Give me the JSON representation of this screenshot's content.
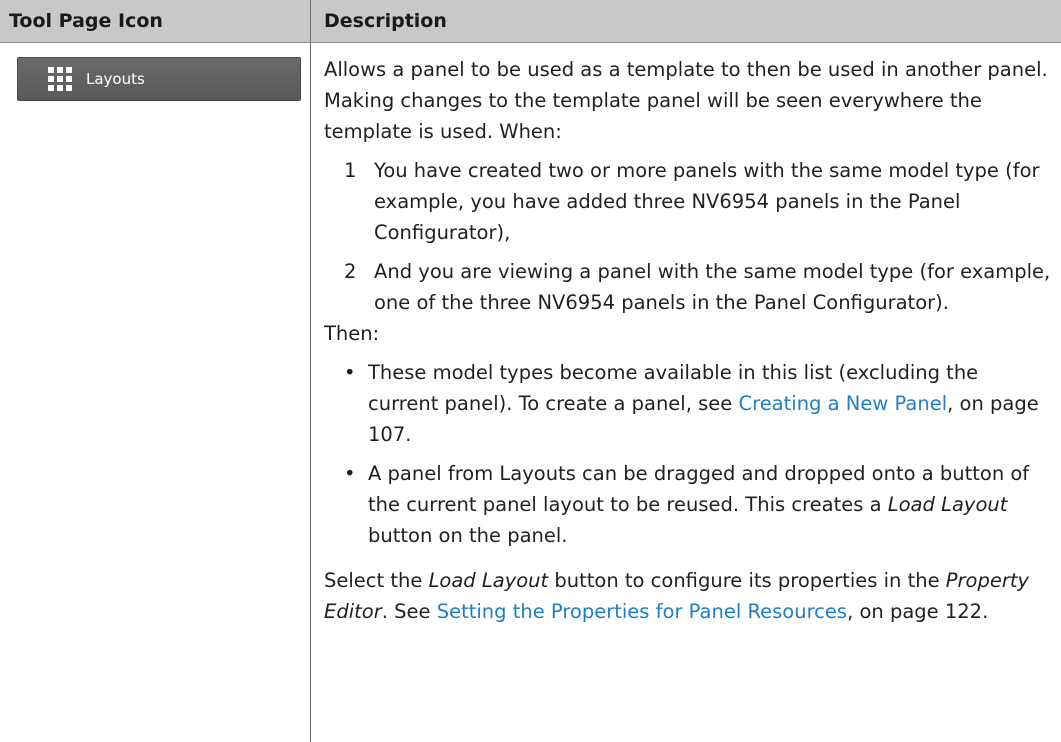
{
  "table": {
    "headers": [
      "Tool Page Icon",
      "Description"
    ],
    "row": {
      "tool_label": "Layouts",
      "tool_icon": "grid-icon",
      "intro": "Allows a panel to be used as a template to then be used in another panel. Making changes to the template panel will be seen everywhere the template is used. When:",
      "numbered": [
        {
          "num": "1",
          "text": "You have created two or more panels with the same model type (for example, you have added three NV6954 panels in the Panel Configurator),"
        },
        {
          "num": "2",
          "text": "And you are viewing a panel with the same model type (for example, one of the three NV6954 panels in the Panel Configurator)."
        }
      ],
      "then": "Then:",
      "bullet1": {
        "bullet": "•",
        "before": "These model types become available in this list (excluding the current panel). To create a panel, see ",
        "link": "Creating a New Panel",
        "after": ", on page 107."
      },
      "bullet2": {
        "bullet": "•",
        "before": "A panel from Layouts can be dragged and dropped onto a button of the current panel layout to be reused. This creates a ",
        "italic": "Load Layout",
        "after": " button on the panel."
      },
      "closing": {
        "t1": "Select the ",
        "i1": "Load Layout",
        "t2": " button to configure its properties in the ",
        "i2": "Property Editor",
        "t3": ". See ",
        "link": "Setting the Properties for Panel Resources",
        "t4": ", on page 122."
      }
    }
  },
  "colors": {
    "header_bg": "#c8c8c8",
    "link": "#1e7ec4",
    "button_bg": "#5f5f5f"
  }
}
